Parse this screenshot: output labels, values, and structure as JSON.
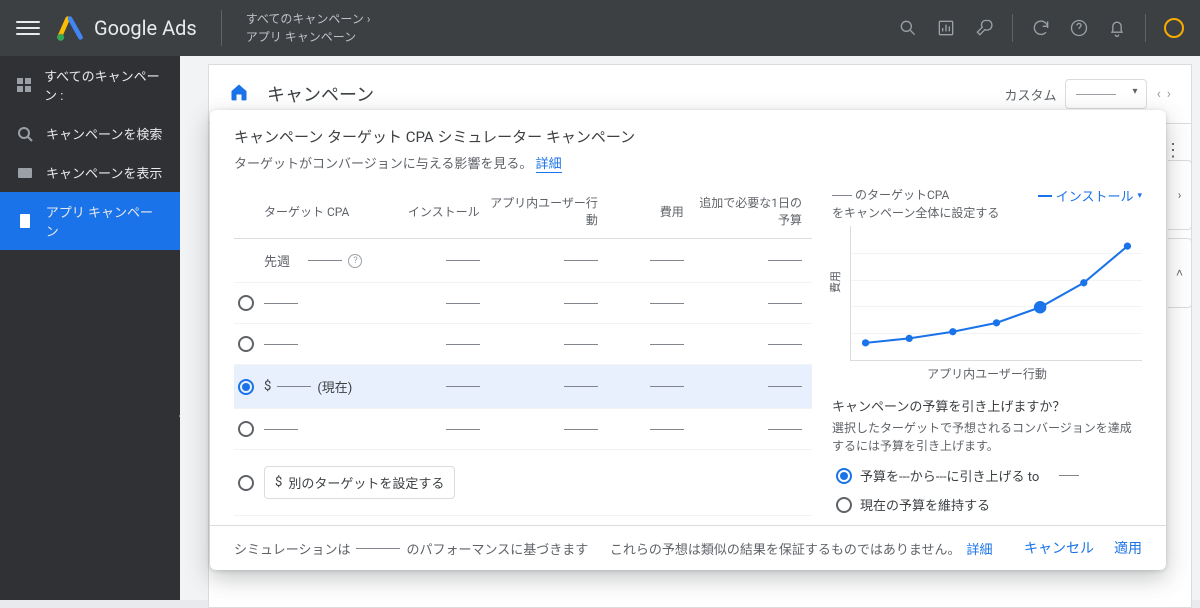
{
  "topbar": {
    "product": "Google Ads",
    "breadcrumb_top": "すべてのキャンペーン",
    "breadcrumb_current": "アプリ キャンペーン"
  },
  "leftnav": {
    "items": [
      {
        "label": "すべてのキャンペーン :"
      },
      {
        "label": "キャンペーンを検索"
      },
      {
        "label": "キャンペーンを表示"
      },
      {
        "label": "アプリ キャンペーン"
      }
    ]
  },
  "canvas": {
    "title": "キャンペーン",
    "custom_label": "カスタム"
  },
  "modal": {
    "title": "キャンペーン ターゲット CPA シミュレーター キャンペーン",
    "subtitle_prefix": "ターゲットがコンバージョンに与える影響を見る。",
    "subtitle_link": "詳細",
    "columns": {
      "target_cpa": "ターゲット CPA",
      "installs": "インストール",
      "in_app": "アプリ内ユーザー行動",
      "cost": "費用",
      "additional_budget": "追加で必要な1日の予算"
    },
    "last_week_label": "先週",
    "current_suffix": "(現在)",
    "currency": "$",
    "alt_target_btn": "別のターゲットを設定する",
    "chart": {
      "head_line1_prefix": "のターゲットCPA",
      "head_line2": "をキャンペーン全体に設定する",
      "metric_selected": "インストール",
      "ylab": "費用",
      "xlab": "アプリ内ユーザー行動"
    },
    "budget": {
      "question": "キャンペーンの予算を引き上げますか？",
      "desc": "選択したターゲットで予想されるコンバージョンを達成するには予算を引き上げます。",
      "opt_raise_prefix": "予算を---から---に引き上げる to",
      "opt_keep": "現在の予算を維持する"
    },
    "footer": {
      "sim_based_prefix": "シミュレーションは",
      "sim_based_suffix": "のパフォーマンスに基づきます",
      "disclaimer": "これらの予想は類似の結果を保証するものではありません。",
      "details": "詳細",
      "cancel": "キャンセル",
      "apply": "適用"
    }
  },
  "chart_data": {
    "type": "line",
    "title": "",
    "xlabel": "アプリ内ユーザー行動",
    "ylabel": "費用",
    "x": [
      0,
      1,
      2,
      3,
      4,
      5,
      6
    ],
    "values": [
      8,
      12,
      18,
      26,
      40,
      62,
      95
    ],
    "highlight_index": 4,
    "ylim": [
      0,
      100
    ]
  }
}
